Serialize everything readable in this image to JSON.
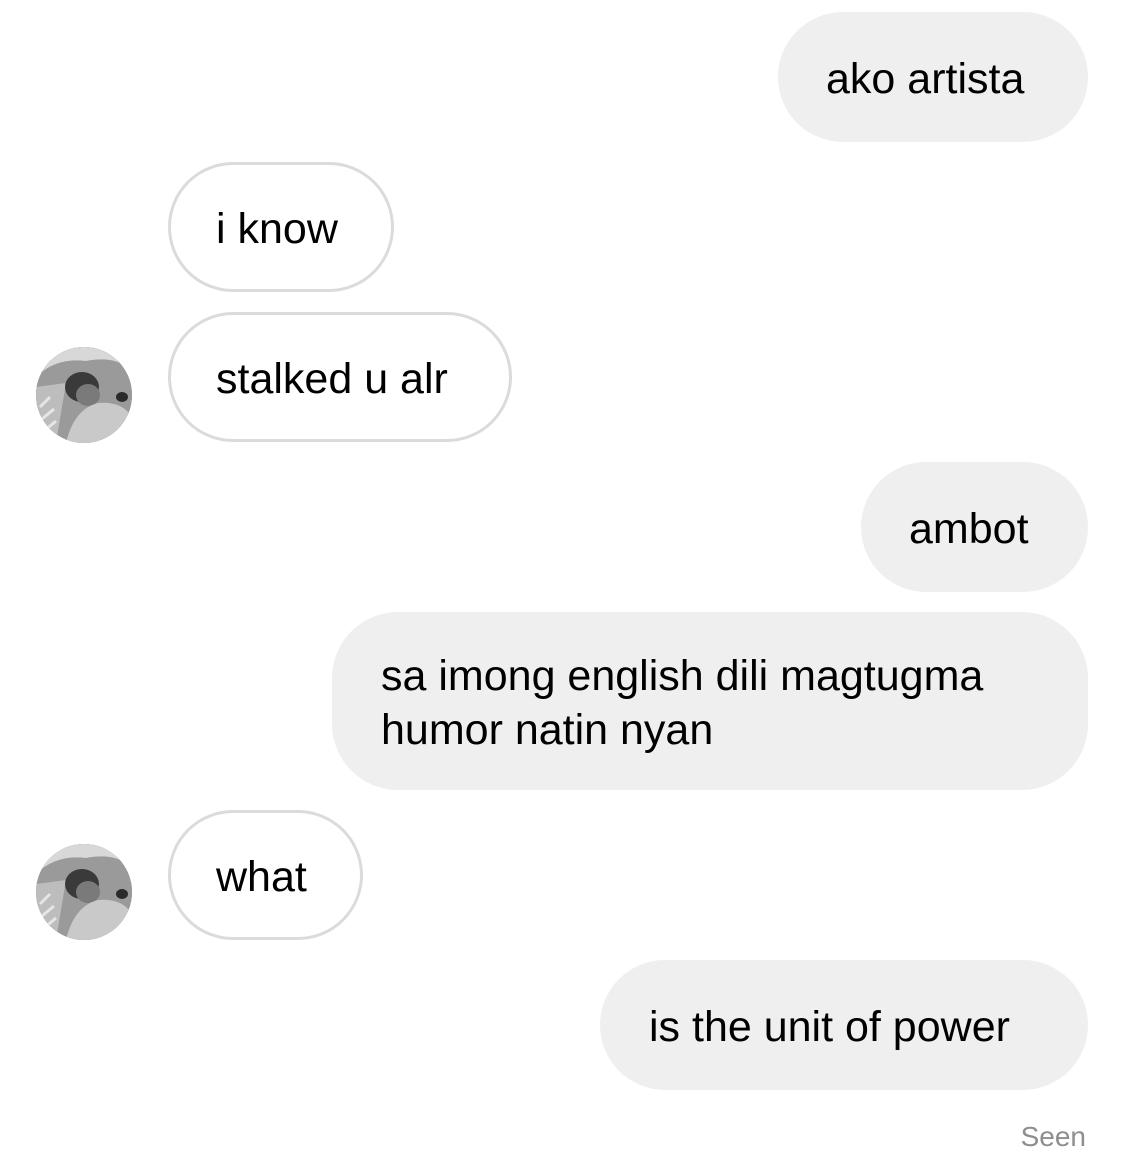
{
  "messages": [
    {
      "sender": "me",
      "text": "ako artista"
    },
    {
      "sender": "them",
      "text": "i know"
    },
    {
      "sender": "them",
      "text": "stalked u alr"
    },
    {
      "sender": "me",
      "text": "ambot"
    },
    {
      "sender": "me",
      "lines": [
        "sa imong english dili magtugma",
        "humor natin nyan"
      ]
    },
    {
      "sender": "them",
      "text": "what"
    },
    {
      "sender": "me",
      "text": "is the unit of power"
    }
  ],
  "status": {
    "seen_label": "Seen"
  },
  "colors": {
    "sent_bubble": "#efefef",
    "received_border": "#dbdbdb",
    "seen_text": "#8e8e8e"
  },
  "icons": {
    "avatar": "profile-photo-avatar"
  }
}
